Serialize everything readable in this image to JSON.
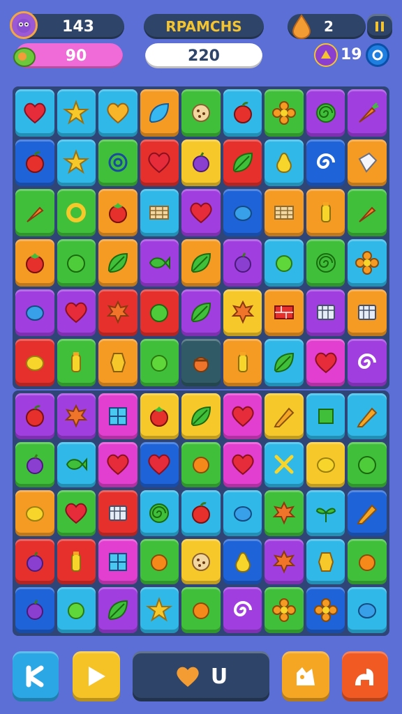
{
  "hud": {
    "score": "143",
    "title": "RPAMCHS",
    "lives": "2",
    "pink_counter": "90",
    "progress": "220",
    "gems": "19"
  },
  "colors": {
    "background": "#5b6fd6",
    "hud_pill": "#2e4468",
    "pink_pill": "#f06ad8",
    "title_text": "#f4c430"
  },
  "board_top": [
    [
      "cyan:heart",
      "cyan:star",
      "cyan:heart-gold",
      "orange:leaf-blue",
      "green:cookie",
      "cyan:apple",
      "green:flower",
      "purple:swirl",
      "purple:carrot"
    ],
    [
      "blue:apple",
      "cyan:star",
      "green:swirl-blue",
      "red:heart",
      "yellow:plum",
      "red:leaf",
      "cyan:pear",
      "blue:spiral",
      "orange:cube-white"
    ],
    [
      "green:carrot",
      "green:ring",
      "orange:tomato",
      "cyan:block",
      "purple:heart",
      "blue:egg",
      "orange:block",
      "orange:bottle",
      "green:carrot"
    ],
    [
      "orange:tomato",
      "green:bush",
      "orange:leaf",
      "purple:fish",
      "orange:leaf",
      "purple:plum",
      "cyan:lime",
      "green:swirl",
      "cyan:flower"
    ],
    [
      "purple:egg",
      "purple:heart",
      "red:maple",
      "red:bush",
      "purple:leaf",
      "yellow:maple",
      "orange:brick",
      "purple:box",
      "orange:box"
    ],
    [
      "red:lemon",
      "green:bottle",
      "orange:crystal",
      "green:lime",
      "teal:acorn",
      "orange:bottle",
      "cyan:leaf",
      "magenta:heart",
      "purple:spiral"
    ]
  ],
  "board_bottom": [
    [
      "purple:apple",
      "purple:maple",
      "magenta:window",
      "yellow:tomato",
      "yellow:leaf",
      "magenta:heart",
      "yellow:pencil",
      "cyan:cube",
      "cyan:pencil"
    ],
    [
      "green:plum",
      "cyan:fish",
      "magenta:heart",
      "blue:heart",
      "green:orange",
      "magenta:heart",
      "cyan:cross",
      "yellow:lemon",
      "green:bush"
    ],
    [
      "orange:lemon",
      "green:heart",
      "red:box",
      "cyan:swirl",
      "cyan:apple",
      "cyan:egg",
      "green:maple",
      "cyan:sprout",
      "blue:pencil"
    ],
    [
      "red:plum",
      "red:bottle",
      "magenta:window",
      "green:orange",
      "yellow:cookie",
      "blue:pear",
      "purple:maple",
      "cyan:crystal",
      "green:orange"
    ],
    [
      "blue:plum",
      "cyan:lime",
      "purple:leaf",
      "cyan:star",
      "green:orange",
      "purple:spiral",
      "green:flower",
      "blue:flower",
      "cyan:egg"
    ]
  ],
  "controls": {
    "center_label": "U"
  }
}
